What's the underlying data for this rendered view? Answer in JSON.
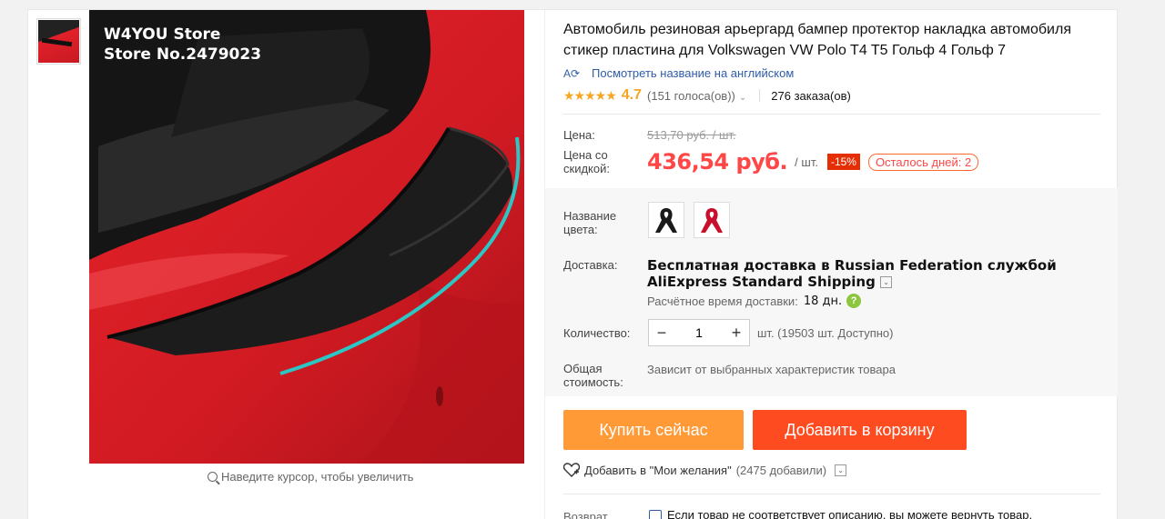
{
  "gallery": {
    "store_line1": "W4YOU Store",
    "store_line2": "Store No.2479023",
    "zoom_hint": "Наведите курсор, чтобы увеличить"
  },
  "product": {
    "title": "Автомобиль резиновая арьергард бампер протектор накладка автомобиля стикер пластина для Volkswagen VW Polo T4 T5 Гольф 4 Гольф 7",
    "translate_link": "Посмотреть название на английском",
    "rating_value": "4.7",
    "votes": "(151 голоса(ов))",
    "orders": "276 заказа(ов)"
  },
  "price": {
    "price_label": "Цена:",
    "old_price": "513,70 руб. / шт.",
    "discount_label_1": "Цена со",
    "discount_label_2": "скидкой:",
    "current_price": "436,54 руб.",
    "unit": "/ шт.",
    "discount_badge": "-15%",
    "days_left": "Осталось дней: 2"
  },
  "options": {
    "color_label_1": "Название",
    "color_label_2": "цвета:",
    "swatches": [
      {
        "name": "black",
        "color": "#1a1a1a"
      },
      {
        "name": "red",
        "color": "#c8102e"
      }
    ]
  },
  "shipping": {
    "label": "Доставка:",
    "text": "Бесплатная доставка в Russian Federation службой AliExpress Standard Shipping",
    "eta_label": "Расчётное время доставки:",
    "eta_value": "18 дн."
  },
  "quantity": {
    "label": "Количество:",
    "minus": "−",
    "value": "1",
    "plus": "+",
    "available": "шт. (19503 шт. Доступно)"
  },
  "total": {
    "label_1": "Общая",
    "label_2": "стоимость:",
    "text": "Зависит от выбранных характеристик товара"
  },
  "actions": {
    "buy_now": "Купить сейчас",
    "add_to_cart": "Добавить в корзину",
    "wishlist": "Добавить в \"Мои желания\"",
    "wishlist_count": "(2475 добавили)"
  },
  "return_policy": {
    "label": "Возврат",
    "text": "Если товар не соответствует описанию, вы можете вернуть товар."
  },
  "colors": {
    "accent": "#ff4747",
    "buy_button": "#ff9a37",
    "cart_button": "#ff4b20",
    "link": "#2e5da8",
    "star": "#f5a623"
  }
}
